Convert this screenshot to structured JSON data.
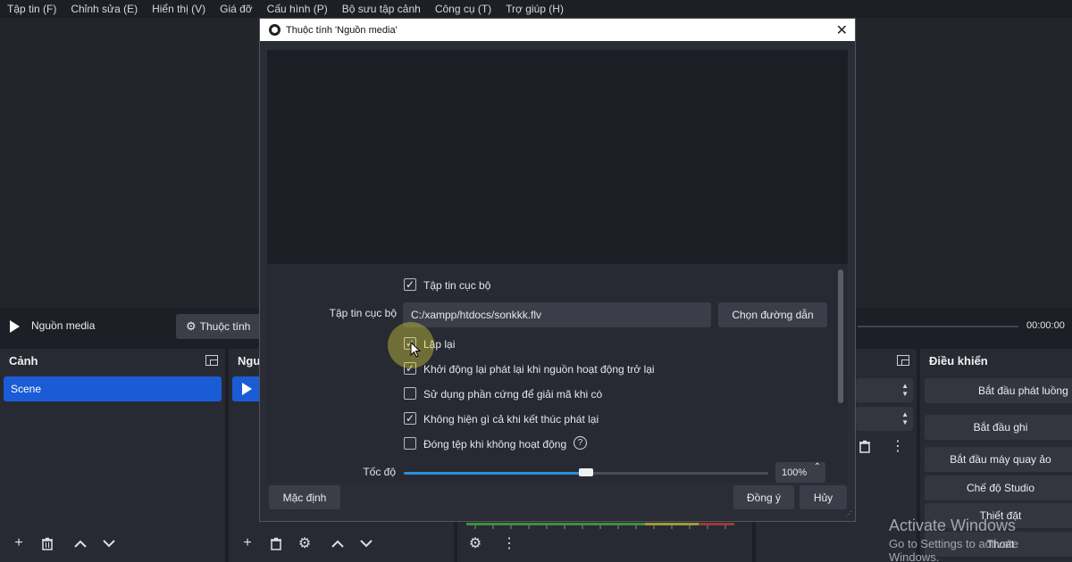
{
  "menu": [
    "Tập tin (F)",
    "Chỉnh sửa (E)",
    "Hiển thị (V)",
    "Giá đỡ",
    "Cấu hình (P)",
    "Bộ sưu tập cảnh",
    "Công cụ (T)",
    "Trợ giúp (H)"
  ],
  "source_toolbar": {
    "source_name": "Nguồn media",
    "properties_label": "Thuộc tính",
    "time": "00:00:00"
  },
  "scenes_dock": {
    "title": "Cảnh",
    "items": [
      "Scene"
    ]
  },
  "sources_dock": {
    "title_partial": "Ngu"
  },
  "controls_dock": {
    "title": "Điều khiển",
    "buttons": [
      "Bắt đầu phát luồng",
      "Bắt đầu ghi",
      "Bắt đầu máy quay ảo",
      "Chế độ Studio",
      "Thiết đặt",
      "Thoát"
    ]
  },
  "dialog": {
    "title": "Thuộc tính 'Nguồn media'",
    "local_file_checkbox": {
      "label": "Tập tin cục bộ",
      "checked": true
    },
    "local_file_field": {
      "label": "Tập tin cục bộ",
      "value": "C:/xampp/htdocs/sonkkk.flv"
    },
    "browse_button": "Chọn đường dẫn",
    "options": [
      {
        "label": "Lặp lại",
        "checked": true
      },
      {
        "label": "Khởi động lại phát lại khi nguồn hoạt động trở lại",
        "checked": true
      },
      {
        "label": "Sử dụng phần cứng để giải mã khi có",
        "checked": false
      },
      {
        "label": "Không hiện gì cả khi kết thúc phát lại",
        "checked": true
      },
      {
        "label": "Đóng tệp khi không hoạt động",
        "checked": false
      }
    ],
    "speed": {
      "label": "Tốc độ",
      "value": "100%",
      "level": 0.5
    },
    "defaults_button": "Mặc định",
    "ok_button": "Đồng ý",
    "cancel_button": "Hủy"
  },
  "watermark": {
    "title": "Activate Windows",
    "subtitle": "Go to Settings to activate Windows."
  },
  "colors": {
    "accent": "#1a5cd6",
    "slider_fill": "#2b8fe0",
    "background": "#1d1f26",
    "panel": "#272a33"
  }
}
